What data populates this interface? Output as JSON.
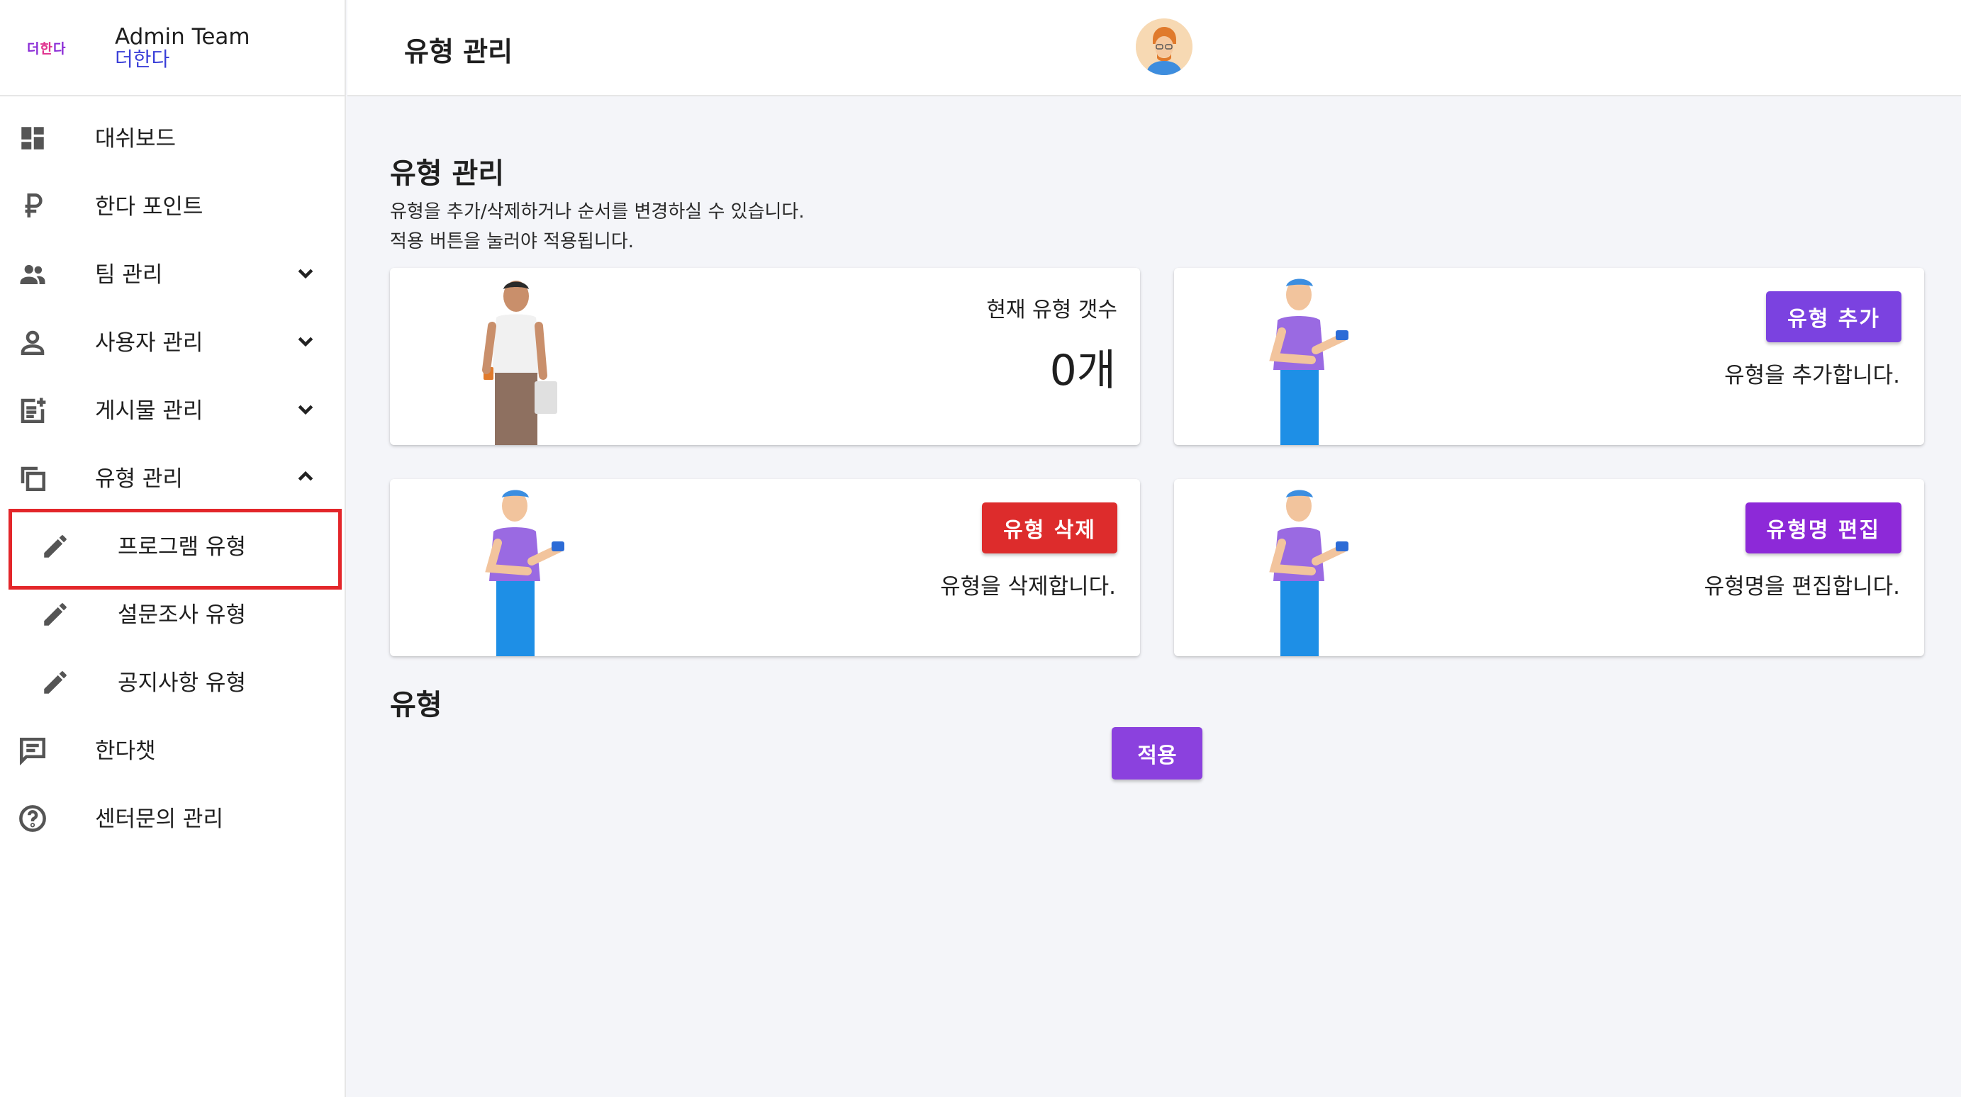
{
  "brand": {
    "logo_left": "더",
    "logo_mid": "한",
    "logo_right": "다",
    "title": "Admin Team",
    "subtitle": "더한다"
  },
  "sidebar": {
    "items": [
      {
        "label": "대쉬보드",
        "icon": "dashboard-icon"
      },
      {
        "label": "한다 포인트",
        "icon": "ruble-icon"
      },
      {
        "label": "팀 관리",
        "icon": "people-icon",
        "expanded": false
      },
      {
        "label": "사용자 관리",
        "icon": "person-icon",
        "expanded": false
      },
      {
        "label": "게시물 관리",
        "icon": "post-add-icon",
        "expanded": false
      },
      {
        "label": "유형 관리",
        "icon": "library-icon",
        "expanded": true
      },
      {
        "label": "프로그램 유형",
        "icon": "pencil-icon",
        "sub": true
      },
      {
        "label": "설문조사 유형",
        "icon": "pencil-icon",
        "sub": true
      },
      {
        "label": "공지사항 유형",
        "icon": "pencil-icon",
        "sub": true
      },
      {
        "label": "한다챗",
        "icon": "chat-icon"
      },
      {
        "label": "센터문의 관리",
        "icon": "help-icon"
      }
    ]
  },
  "header": {
    "title": "유형 관리"
  },
  "main": {
    "heading": "유형 관리",
    "desc_line1": "유형을 추가/삭제하거나 순서를 변경하실 수 있습니다.",
    "desc_line2": "적용 버튼을 눌러야 적용됩니다.",
    "count_card": {
      "label": "현재 유형 갯수",
      "value": "0개"
    },
    "add_card": {
      "button": "유형 추가",
      "desc": "유형을 추가합니다."
    },
    "delete_card": {
      "button": "유형 삭제",
      "desc": "유형을 삭제합니다."
    },
    "edit_card": {
      "button": "유형명 편집",
      "desc": "유형명을 편집합니다."
    },
    "section_title": "유형",
    "apply_button": "적용"
  },
  "colors": {
    "accent_purple": "#7b42e0",
    "danger_red": "#dd2c2c",
    "edit_purple": "#8d29d8",
    "highlight_red": "#e3262a",
    "brand_blue": "#3a3fd8"
  }
}
